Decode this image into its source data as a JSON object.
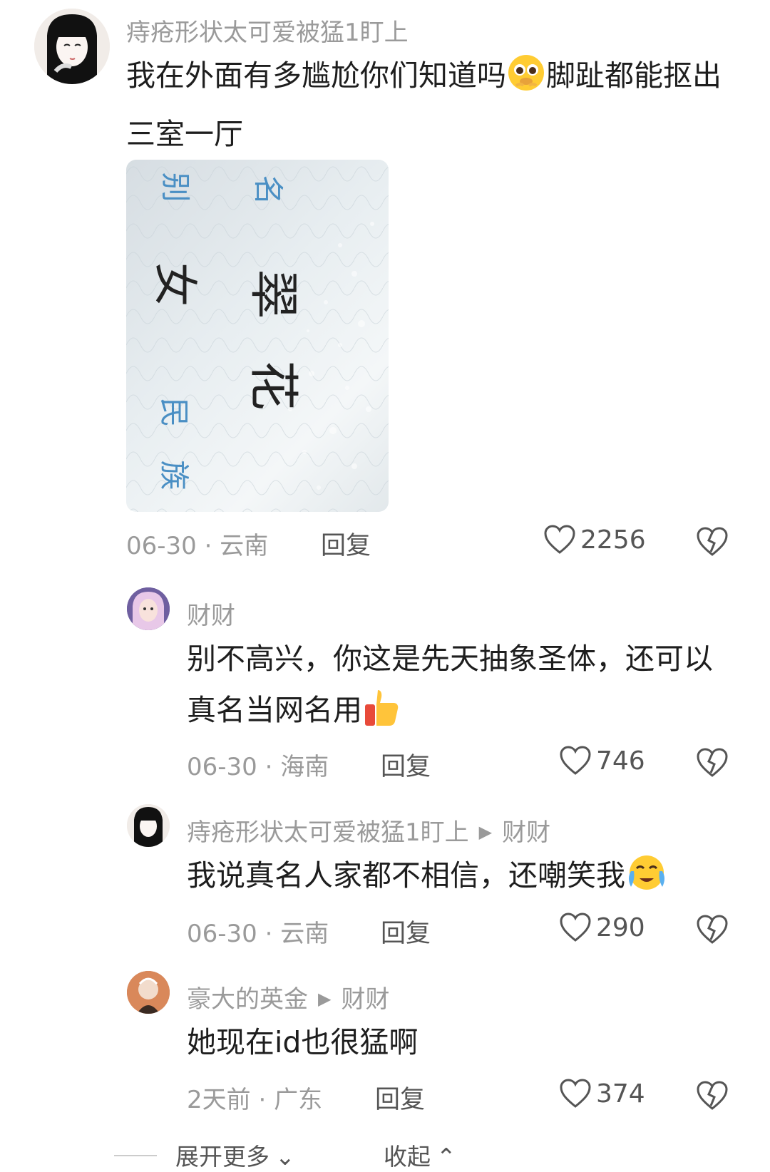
{
  "comments": [
    {
      "username": "痔疮形状太可爱被猛1盯上",
      "text_part1": "我在外面有多尴尬你们知道吗",
      "emoji1": "pleading-face-emoji",
      "text_part2": "脚趾都能抠出三室一厅",
      "date": "06-30",
      "location": "云南",
      "reply": "回复",
      "likes": "2256",
      "image": {
        "label_name": "名",
        "label_sex": "别",
        "label_ethnic": "民",
        "label_ethnic2": "族",
        "name_value_1": "翠",
        "name_value_2": "花",
        "sex_value": "女"
      }
    },
    {
      "username": "财财",
      "text": "别不高兴，你这是先天抽象圣体，还可以真名当网名用",
      "emoji": "thumbs-up-emoji",
      "date": "06-30",
      "location": "海南",
      "reply": "回复",
      "likes": "746"
    },
    {
      "username": "痔疮形状太可爱被猛1盯上",
      "reply_to": "财财",
      "text": "我说真名人家都不相信，还嘲笑我",
      "emoji": "crying-face-emoji",
      "date": "06-30",
      "location": "云南",
      "reply": "回复",
      "likes": "290"
    },
    {
      "username": "豪大的英金",
      "reply_to": "财财",
      "text": "她现在id也很猛啊",
      "date": "2天前",
      "location": "广东",
      "reply": "回复",
      "likes": "374"
    }
  ],
  "footer": {
    "expand_more": "展开更多",
    "collapse": "收起"
  },
  "colors": {
    "text_primary": "#1e1e1e",
    "text_secondary": "#9a9a9a",
    "id_card_label": "#4a8fc4"
  }
}
